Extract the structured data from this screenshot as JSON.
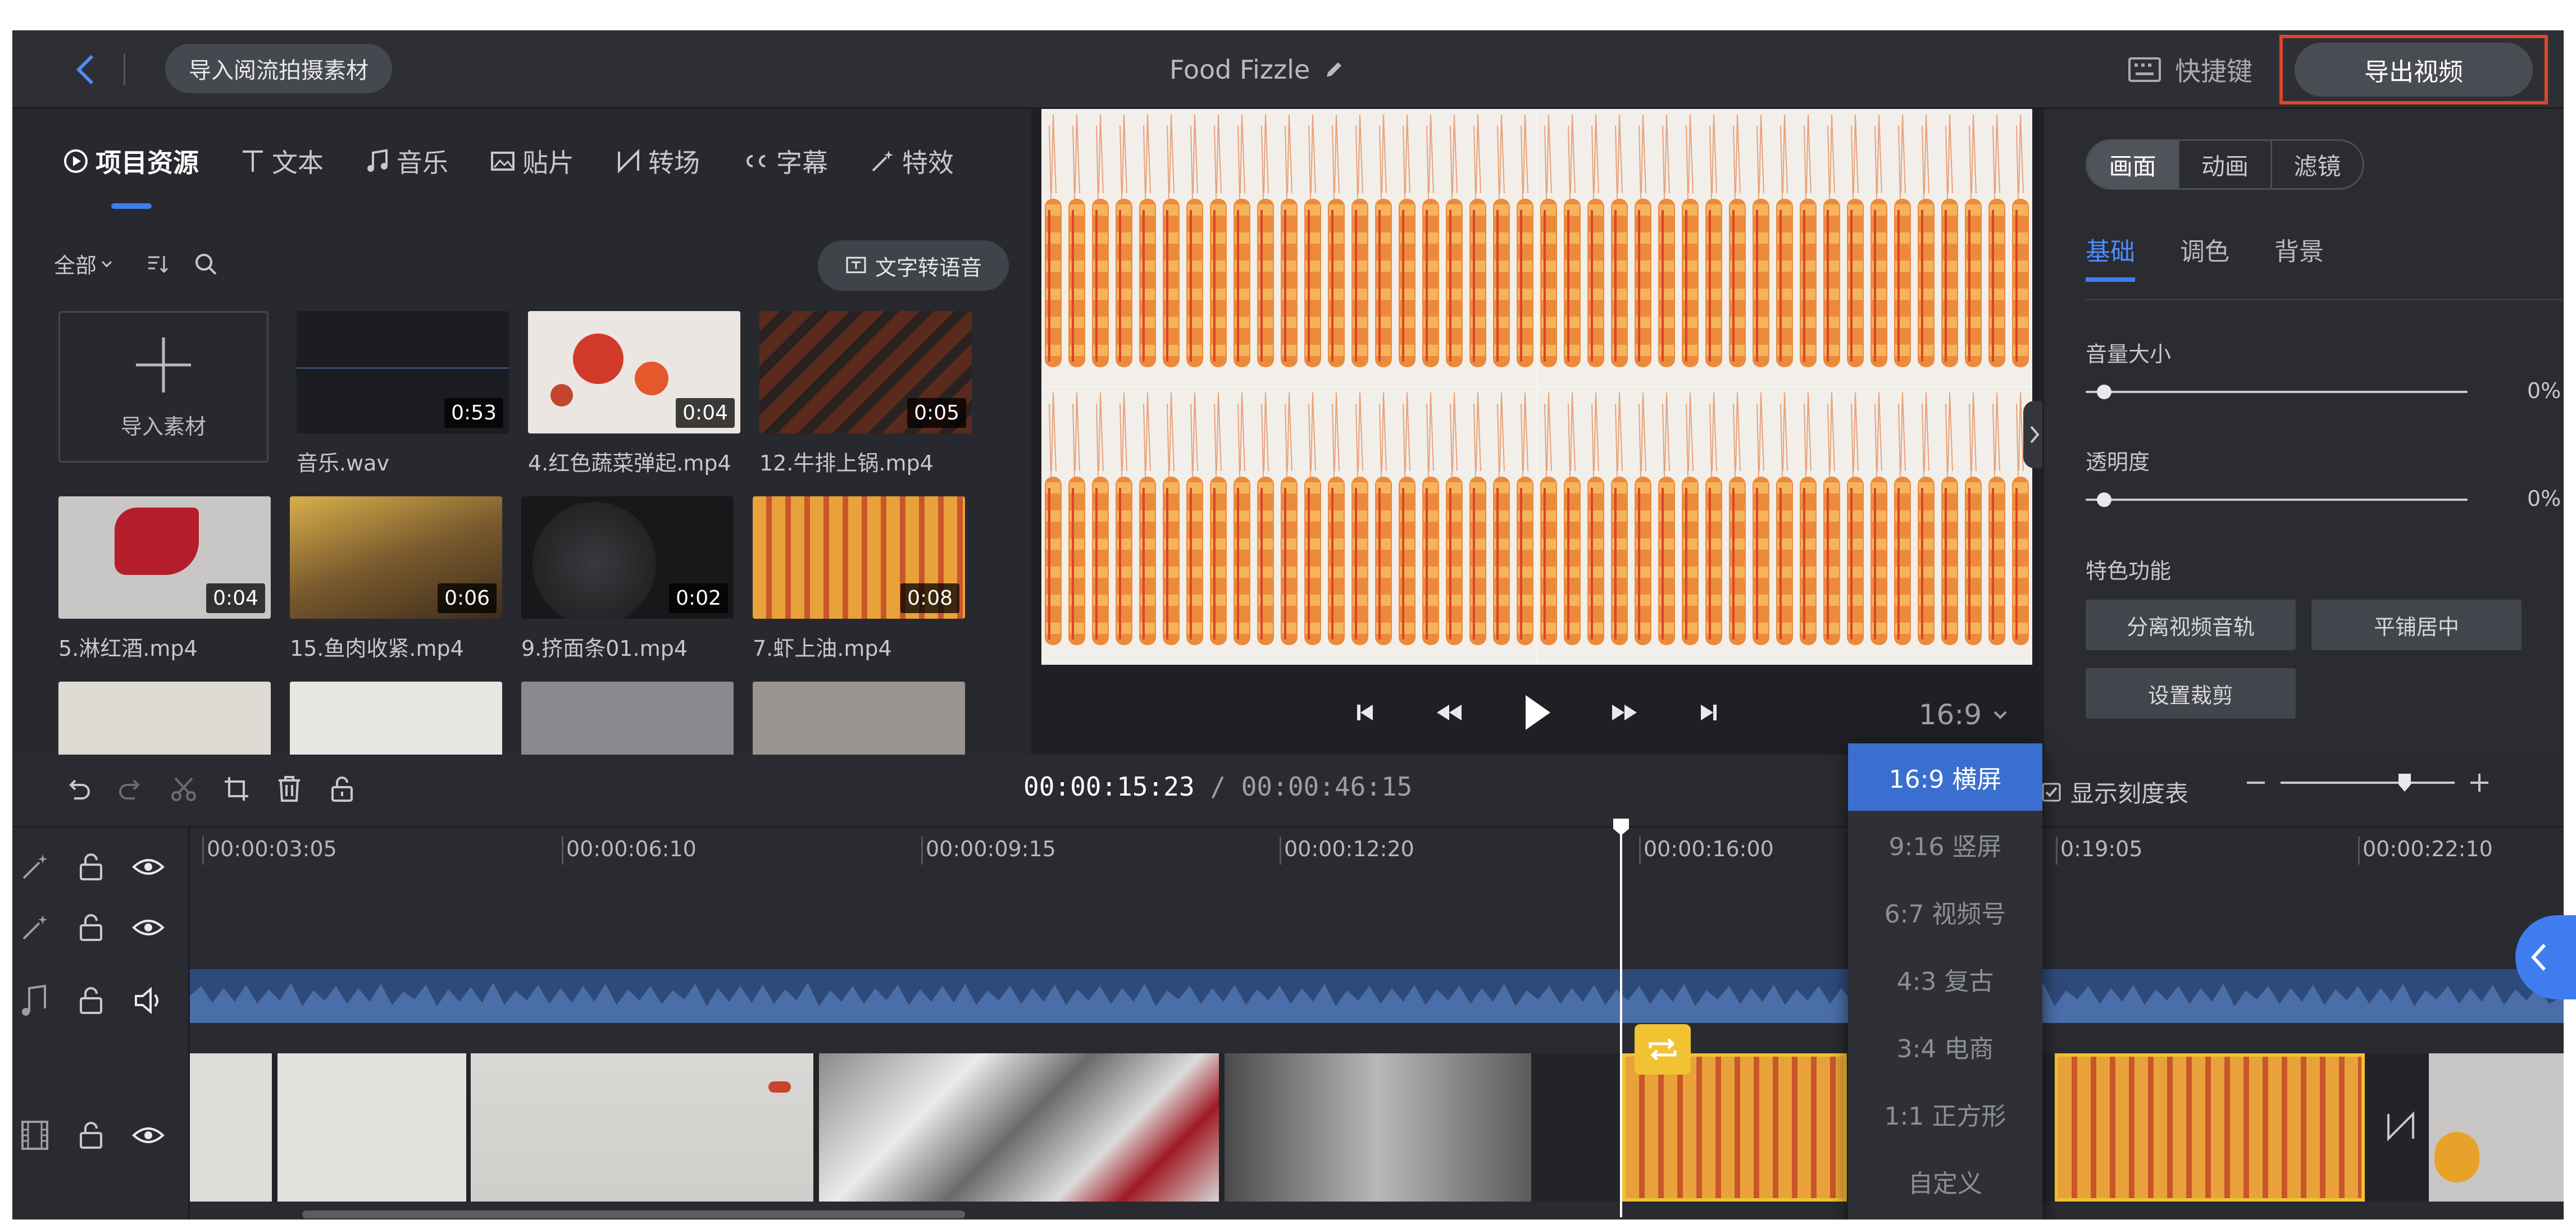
{
  "topbar": {
    "import_label": "导入阅流拍摄素材",
    "project_title": "Food Fizzle",
    "shortcut_label": "快捷键",
    "export_label": "导出视频"
  },
  "left_panel": {
    "tabs": [
      {
        "label": "项目资源",
        "icon": "play-circle-icon"
      },
      {
        "label": "文本",
        "icon": "text-icon"
      },
      {
        "label": "音乐",
        "icon": "music-note-icon"
      },
      {
        "label": "贴片",
        "icon": "image-icon"
      },
      {
        "label": "转场",
        "icon": "transition-icon"
      },
      {
        "label": "字幕",
        "icon": "cc-icon"
      },
      {
        "label": "特效",
        "icon": "magic-wand-icon"
      }
    ],
    "filter_all": "全部",
    "tts_label": "文字转语音",
    "import_card_label": "导入素材",
    "media": [
      {
        "name": "音乐.wav",
        "duration": "0:53",
        "color": "#1d1e24"
      },
      {
        "name": "4.红色蔬菜弹起.mp4",
        "duration": "0:04",
        "color": "#e6dcd6"
      },
      {
        "name": "12.牛排上锅.mp4",
        "duration": "0:05",
        "color": "#3a2a24"
      },
      {
        "name": "5.淋红酒.mp4",
        "duration": "0:04",
        "color": "#c9c6c6"
      },
      {
        "name": "15.鱼肉收紧.mp4",
        "duration": "0:06",
        "color": "#8d6b3a"
      },
      {
        "name": "9.挤面条01.mp4",
        "duration": "0:02",
        "color": "#1c1c1e"
      },
      {
        "name": "7.虾上油.mp4",
        "duration": "0:08",
        "color": "#e3a13c"
      }
    ]
  },
  "preview": {
    "aspect_label": "16:9"
  },
  "right_panel": {
    "segments": [
      "画面",
      "动画",
      "滤镜"
    ],
    "subtabs": [
      "基础",
      "调色",
      "背景"
    ],
    "volume_label": "音量大小",
    "volume_value": "0%",
    "opacity_label": "透明度",
    "opacity_value": "0%",
    "feature_title": "特色功能",
    "btn_split_audio": "分离视频音轨",
    "btn_tile_center": "平铺居中",
    "btn_crop": "设置裁剪"
  },
  "timeline": {
    "current_time": "00:00:15:23",
    "separator": " / ",
    "total_time": "00:00:46:15",
    "show_ruler_label": "显示刻度表",
    "ruler_ticks": [
      "00:00:03:05",
      "00:00:06:10",
      "00:00:09:15",
      "00:00:12:20",
      "00:00:16:00",
      "0:19:05",
      "00:00:22:10"
    ]
  },
  "ratio_options": [
    "16:9 横屏",
    "9:16 竖屏",
    "6:7 视频号",
    "4:3 复古",
    "3:4 电商",
    "1:1 正方形",
    "自定义"
  ],
  "colors": {
    "accent": "#3f7cf0",
    "export_highlight": "#e0452b",
    "clip_selected": "#f1c232"
  }
}
